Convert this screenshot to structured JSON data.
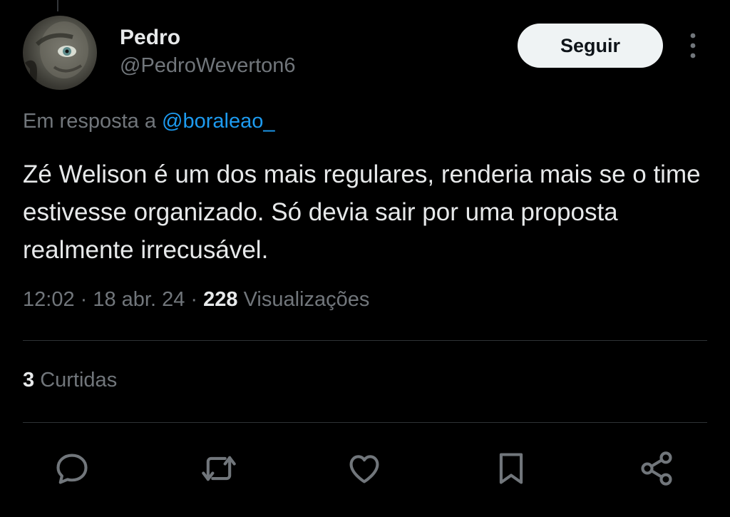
{
  "user": {
    "display_name": "Pedro",
    "handle": "@PedroWeverton6"
  },
  "follow_button": {
    "label": "Seguir"
  },
  "reply_context": {
    "prefix": "Em resposta a",
    "mention": "@boraleao_"
  },
  "tweet": {
    "text": "Zé Welison é um dos mais regulares, renderia mais se o time estivesse organizado. Só devia sair por uma proposta realmente irrecusável."
  },
  "meta": {
    "time": "12:02",
    "separator": " · ",
    "date": "18 abr. 24",
    "views_count": "228",
    "views_label": "Visualizações"
  },
  "likes": {
    "count": "3",
    "label": "Curtidas"
  },
  "actions": {
    "icons": [
      "reply-icon",
      "retweet-icon",
      "like-icon",
      "bookmark-icon",
      "share-icon"
    ]
  },
  "colors": {
    "background": "#000000",
    "text_primary": "#e7e9ea",
    "text_secondary": "#71767b",
    "link": "#1d9bf0",
    "divider": "#2f3336",
    "follow_bg": "#eff3f4"
  }
}
